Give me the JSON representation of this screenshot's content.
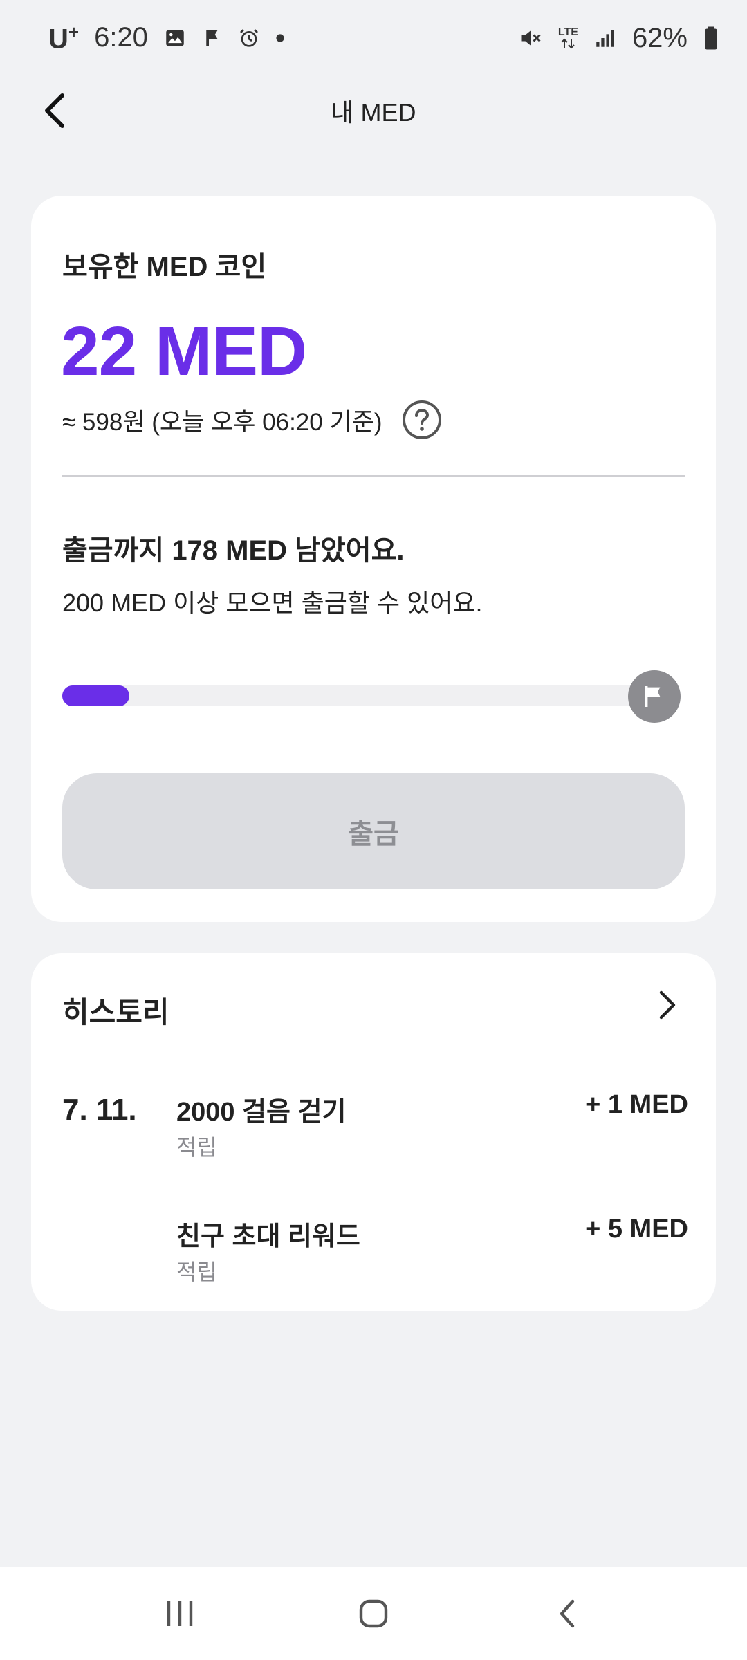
{
  "status_bar": {
    "carrier": "U",
    "carrier_sup": "+",
    "time": "6:20",
    "network": "LTE",
    "battery": "62%"
  },
  "header": {
    "title": "내 MED"
  },
  "balance": {
    "label": "보유한 MED 코인",
    "value": "22 MED",
    "fiat": "≈ 598원 (오늘 오후 06:20 기준)",
    "remaining_title": "출금까지 178 MED 남았어요.",
    "remaining_desc": "200 MED 이상 모으면 출금할 수 있어요.",
    "progress": 0.11,
    "withdraw_label": "출금"
  },
  "history": {
    "title": "히스토리",
    "date": "7. 11.",
    "items": [
      {
        "name": "2000 걸음 걷기",
        "type": "적립",
        "amount": "+ 1 MED"
      },
      {
        "name": "친구 초대 리워드",
        "type": "적립",
        "amount": "+ 5 MED"
      }
    ]
  },
  "colors": {
    "accent": "#6a2ee8",
    "background": "#f1f2f4",
    "card": "#ffffff",
    "disabled_button": "#dcdde1"
  },
  "icons": {
    "back": "back-arrow-icon",
    "help": "question-circle-icon",
    "flag": "flag-icon",
    "chevron": "chevron-right-icon"
  }
}
